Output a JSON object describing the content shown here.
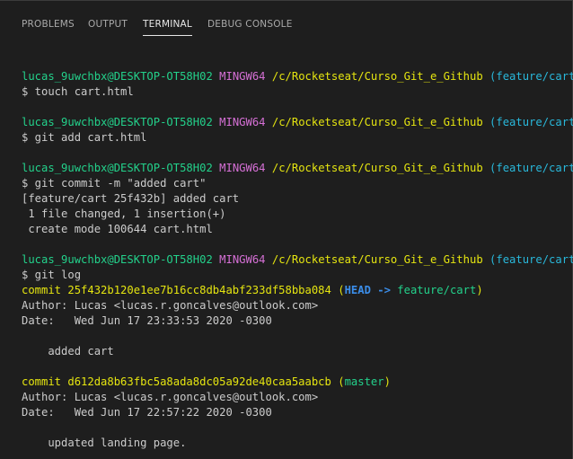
{
  "tabs": [
    {
      "label": "PROBLEMS"
    },
    {
      "label": "OUTPUT"
    },
    {
      "label": "TERMINAL",
      "active": true
    },
    {
      "label": "DEBUG CONSOLE"
    }
  ],
  "prompt": {
    "user_host": "lucas_9uwchbx@DESKTOP-OT58H02",
    "shell": "MINGW64",
    "path": "/c/Rocketseat/Curso_Git_e_Github",
    "branch": "(feature/cart)"
  },
  "commands": [
    {
      "cmd": "$ touch cart.html"
    },
    {
      "cmd": "$ git add cart.html"
    },
    {
      "cmd": "$ git commit -m \"added cart\"",
      "output": [
        "[feature/cart 25f432b] added cart",
        " 1 file changed, 1 insertion(+)",
        " create mode 100644 cart.html"
      ]
    },
    {
      "cmd": "$ git log"
    }
  ],
  "log": [
    {
      "commit_label": "commit 25f432b120e1ee7b16cc8db4abf233df58bba084",
      "ref_open": "(",
      "ref_head": "HEAD -> ",
      "ref_branch": "feature/cart",
      "ref_close": ")",
      "author": "Author: Lucas <lucas.r.goncalves@outlook.com>",
      "date": "Date:   Wed Jun 17 23:33:53 2020 -0300",
      "message": "    added cart"
    },
    {
      "commit_label": "commit d612da8b63fbc5a8ada8dc05a92de40caa5aabcb",
      "ref_open": "(",
      "ref_branch": "master",
      "ref_close": ")",
      "author": "Author: Lucas <lucas.r.goncalves@outlook.com>",
      "date": "Date:   Wed Jun 17 22:57:22 2020 -0300",
      "message": "    updated landing page."
    }
  ],
  "colors": {
    "background": "#1e1e1e",
    "user_host": "#23d18b",
    "shell": "#d670d6",
    "path": "#e5e510",
    "branch": "#29b8db",
    "head_ref": "#3b8eea"
  }
}
